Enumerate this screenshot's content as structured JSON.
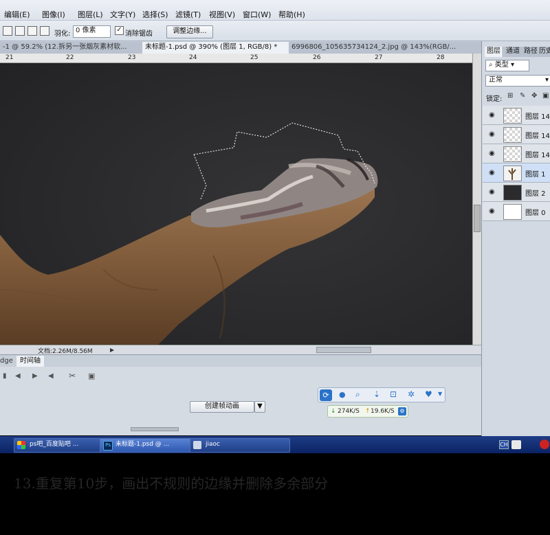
{
  "menu": [
    "编辑(E)",
    "图像(I)",
    "图层(L)",
    "文字(Y)",
    "选择(S)",
    "滤镜(T)",
    "视图(V)",
    "窗口(W)",
    "帮助(H)"
  ],
  "options": {
    "feather_label": "羽化:",
    "feather_value": "0 像素",
    "antialias_label": "消除锯齿",
    "antialias_checked": "✓",
    "refine_edge_button": "调整边缘..."
  },
  "tabs": [
    "-1 @ 59.2% (12.拆另一张烟灰素材软...",
    "未标题-1.psd @ 390% (图层 1, RGB/8) *",
    "6996806_105635734124_2.jpg @ 143%(RGB/..."
  ],
  "ruler": [
    "21",
    "22",
    "23",
    "24",
    "25",
    "26",
    "27",
    "28"
  ],
  "status": {
    "doc": "文档:2.26M/8.56M"
  },
  "timeline": {
    "tabs": [
      "dge",
      "时间轴"
    ],
    "create_button": "创建帧动画",
    "download_speed": "274K/S",
    "upload_speed": "19.6K/S"
  },
  "layers_panel": {
    "tabs": [
      "图层",
      "通道",
      "路径",
      "历史"
    ],
    "filter_label": "类型",
    "blend_mode": "正常",
    "lock_label": "锁定:",
    "layers": [
      {
        "name": "图层 14",
        "thumb": "transparent"
      },
      {
        "name": "图层 14",
        "thumb": "transparent"
      },
      {
        "name": "图层 14",
        "thumb": "transparent"
      },
      {
        "name": "图层 1",
        "thumb": "tree"
      },
      {
        "name": "图层 2",
        "thumb": "dark"
      },
      {
        "name": "图层 0",
        "thumb": "white"
      }
    ]
  },
  "taskbar": {
    "items": [
      "ps吧_百度贴吧 ...",
      "未标题-1.psd @ ...",
      "jiaoc"
    ],
    "tray": [
      "CH"
    ]
  },
  "caption": "13.重复第10步，画出不规则的边缘并删除多余部分",
  "colors": {
    "canvas": "#2b2b2d",
    "finger": "#8a6440",
    "taskbar": "#0b2364"
  }
}
